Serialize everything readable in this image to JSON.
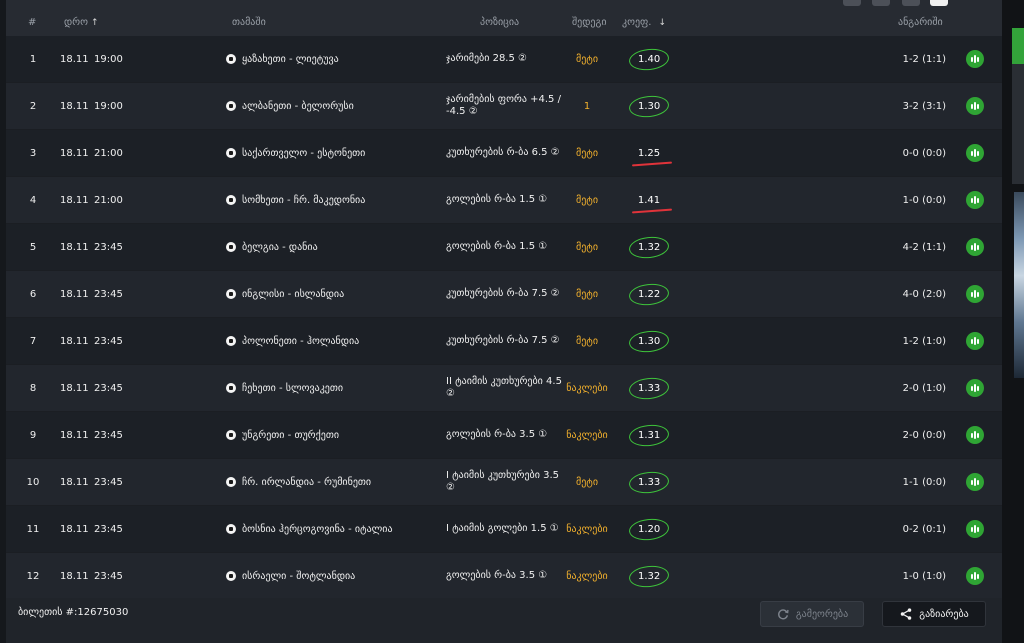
{
  "header": {
    "num": "#",
    "time": "დრო",
    "game": "თამაში",
    "position": "პოზიცია",
    "bet": "შედეგი",
    "odds": "კოეფ.",
    "result": "ანგარიში"
  },
  "rows": [
    {
      "num": "1",
      "date": "18.11",
      "time": "19:00",
      "game": "ყაზახეთი - ლიეტუვა",
      "position": "ჯარიმები 28.5 ②",
      "bet": "მეტი",
      "odds": "1.40",
      "mark": "circle",
      "score": "1-2 (1:1)"
    },
    {
      "num": "2",
      "date": "18.11",
      "time": "19:00",
      "game": "ალბანეთი - ბელორუსი",
      "position": "ჯარიმების ფორა +4.5 / -4.5 ②",
      "bet": "1",
      "odds": "1.30",
      "mark": "circle",
      "score": "3-2 (3:1)"
    },
    {
      "num": "3",
      "date": "18.11",
      "time": "21:00",
      "game": "საქართველო - ესტონეთი",
      "position": "კუთხურების რ-ბა 6.5 ②",
      "bet": "მეტი",
      "odds": "1.25",
      "mark": "red",
      "score": "0-0 (0:0)"
    },
    {
      "num": "4",
      "date": "18.11",
      "time": "21:00",
      "game": "სომხეთი - ჩრ. მაკედონია",
      "position": "გოლების რ-ბა 1.5 ①",
      "bet": "მეტი",
      "odds": "1.41",
      "mark": "red",
      "score": "1-0 (0:0)"
    },
    {
      "num": "5",
      "date": "18.11",
      "time": "23:45",
      "game": "ბელგია - დანია",
      "position": "გოლების რ-ბა 1.5 ①",
      "bet": "მეტი",
      "odds": "1.32",
      "mark": "circle",
      "score": "4-2 (1:1)"
    },
    {
      "num": "6",
      "date": "18.11",
      "time": "23:45",
      "game": "ინგლისი - ისლანდია",
      "position": "კუთხურების რ-ბა 7.5 ②",
      "bet": "მეტი",
      "odds": "1.22",
      "mark": "circle",
      "score": "4-0 (2:0)"
    },
    {
      "num": "7",
      "date": "18.11",
      "time": "23:45",
      "game": "პოლონეთი - ჰოლანდია",
      "position": "კუთხურების რ-ბა 7.5 ②",
      "bet": "მეტი",
      "odds": "1.30",
      "mark": "circle",
      "score": "1-2 (1:0)"
    },
    {
      "num": "8",
      "date": "18.11",
      "time": "23:45",
      "game": "ჩეხეთი - სლოვაკეთი",
      "position": "II ტაიმის კუთხურები 4.5 ②",
      "bet": "ნაკლები",
      "odds": "1.33",
      "mark": "circle",
      "score": "2-0 (1:0)"
    },
    {
      "num": "9",
      "date": "18.11",
      "time": "23:45",
      "game": "უნგრეთი - თურქეთი",
      "position": "გოლების რ-ბა 3.5 ①",
      "bet": "ნაკლები",
      "odds": "1.31",
      "mark": "circle",
      "score": "2-0 (0:0)"
    },
    {
      "num": "10",
      "date": "18.11",
      "time": "23:45",
      "game": "ჩრ. ირლანდია - რუმინეთი",
      "position": "I ტაიმის კუთხურები 3.5 ②",
      "bet": "მეტი",
      "odds": "1.33",
      "mark": "circle",
      "score": "1-1 (0:0)"
    },
    {
      "num": "11",
      "date": "18.11",
      "time": "23:45",
      "game": "ბოსნია ჰერცოგოვინა - იტალია",
      "position": "I ტაიმის გოლები 1.5 ①",
      "bet": "ნაკლები",
      "odds": "1.20",
      "mark": "circle",
      "score": "0-2 (0:1)"
    },
    {
      "num": "12",
      "date": "18.11",
      "time": "23:45",
      "game": "ისრაელი - შოტლანდია",
      "position": "გოლების რ-ბა 3.5 ①",
      "bet": "ნაკლები",
      "odds": "1.32",
      "mark": "circle",
      "score": "1-0 (1:0)"
    }
  ],
  "footer": {
    "ticket": "ბილეთის #:12675030",
    "repeat_label": "გამეორება",
    "share_label": "გაზიარება"
  },
  "colors": {
    "accent_green": "#33a33a",
    "bet_orange": "#f3b12d",
    "mark_red": "#e0333a"
  }
}
